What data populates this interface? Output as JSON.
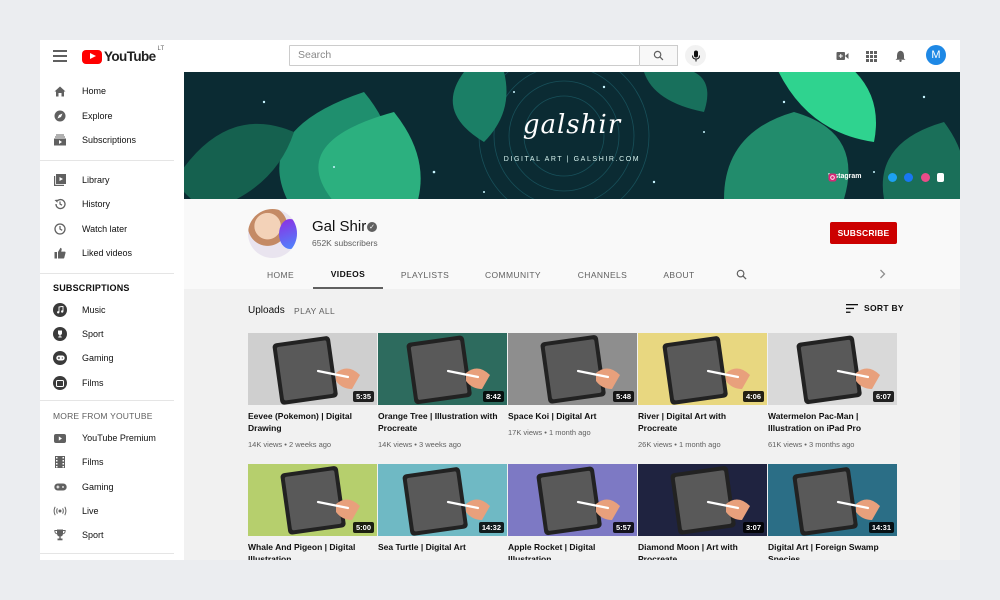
{
  "topbar": {
    "logo_text": "YouTube",
    "logo_country": "LT",
    "search_placeholder": "Search",
    "avatar_letter": "M",
    "icons": [
      "menu-icon",
      "search-icon",
      "mic-icon",
      "create-video-icon",
      "apps-icon",
      "notifications-icon"
    ]
  },
  "sidebar": {
    "main": [
      {
        "label": "Home",
        "icon": "home-icon"
      },
      {
        "label": "Explore",
        "icon": "compass-icon"
      },
      {
        "label": "Subscriptions",
        "icon": "subscriptions-icon"
      }
    ],
    "library": [
      {
        "label": "Library",
        "icon": "library-icon"
      },
      {
        "label": "History",
        "icon": "history-icon"
      },
      {
        "label": "Watch later",
        "icon": "clock-icon"
      },
      {
        "label": "Liked videos",
        "icon": "thumbs-up-icon"
      }
    ],
    "subscriptions_heading": "SUBSCRIPTIONS",
    "subscriptions": [
      {
        "label": "Music",
        "icon": "music-icon"
      },
      {
        "label": "Sport",
        "icon": "trophy-icon"
      },
      {
        "label": "Gaming",
        "icon": "gamepad-icon"
      },
      {
        "label": "Films",
        "icon": "film-icon"
      }
    ],
    "more_heading": "MORE FROM YOUTUBE",
    "more": [
      {
        "label": "YouTube Premium",
        "icon": "youtube-icon"
      },
      {
        "label": "Films",
        "icon": "film-strip-icon"
      },
      {
        "label": "Gaming",
        "icon": "gamepad-icon"
      },
      {
        "label": "Live",
        "icon": "live-icon"
      },
      {
        "label": "Sport",
        "icon": "trophy-icon"
      }
    ]
  },
  "banner": {
    "title": "galshir",
    "subtitle": "DIGITAL ART | GALSHIR.COM",
    "instagram_label": "Instagram",
    "social_icons": [
      "twitter-icon",
      "facebook-icon",
      "dribbble-icon",
      "patreon-icon"
    ]
  },
  "channel": {
    "name": "Gal Shir",
    "verified_mark": "✓",
    "subscribers": "652K subscribers",
    "subscribe_label": "SUBSCRIBE",
    "tabs": [
      "HOME",
      "VIDEOS",
      "PLAYLISTS",
      "COMMUNITY",
      "CHANNELS",
      "ABOUT"
    ],
    "active_tab": "VIDEOS"
  },
  "content": {
    "uploads_label": "Uploads",
    "play_all_label": "PLAY ALL",
    "sort_label": "SORT BY",
    "videos": [
      {
        "title": "Eevee (Pokemon) | Digital Drawing",
        "duration": "5:35",
        "views": "14K views",
        "age": "2 weeks ago",
        "bg": "#cfcfcf"
      },
      {
        "title": "Orange Tree | Illustration with Procreate",
        "duration": "8:42",
        "views": "14K views",
        "age": "3 weeks ago",
        "bg": "#2d6b5e"
      },
      {
        "title": "Space Koi | Digital Art",
        "duration": "5:48",
        "views": "17K views",
        "age": "1 month ago",
        "bg": "#8e8e8e"
      },
      {
        "title": "River | Digital Art with Procreate",
        "duration": "4:06",
        "views": "26K views",
        "age": "1 month ago",
        "bg": "#e8d780"
      },
      {
        "title": "Watermelon Pac-Man | Illustration on iPad Pro",
        "duration": "6:07",
        "views": "61K views",
        "age": "3 months ago",
        "bg": "#d9d9d9"
      },
      {
        "title": "Whale And Pigeon | Digital Illustration",
        "duration": "5:00",
        "views": "",
        "age": "",
        "bg": "#b6cf6d"
      },
      {
        "title": "Sea Turtle | Digital Art",
        "duration": "14:32",
        "views": "",
        "age": "",
        "bg": "#6fb9c4"
      },
      {
        "title": "Apple Rocket | Digital Illustration",
        "duration": "5:57",
        "views": "",
        "age": "",
        "bg": "#7d79c4"
      },
      {
        "title": "Diamond Moon | Art with Procreate",
        "duration": "3:07",
        "views": "",
        "age": "",
        "bg": "#1f2340"
      },
      {
        "title": "Digital Art | Foreign Swamp Species",
        "duration": "14:31",
        "views": "",
        "age": "",
        "bg": "#2b6e86"
      }
    ]
  },
  "colors": {
    "brand_red": "#ff0000",
    "subscribe_red": "#cc0000",
    "avatar_blue": "#1e88e5",
    "banner_teal": "#0b2b33"
  }
}
